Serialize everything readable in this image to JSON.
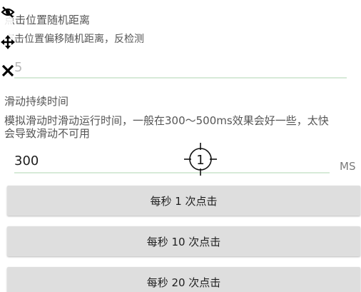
{
  "toolbar": {
    "icons": [
      "eye-off-icon",
      "move-icon",
      "close-icon"
    ]
  },
  "offset": {
    "title": "点击位置随机距离",
    "description": "点击位置偏移随机距离，反检测",
    "input_value": "5"
  },
  "swipe": {
    "title": "滑动持续时间",
    "description_line1": "模拟滑动时滑动运行时间，一般在300～500ms效果会好一些，太快",
    "description_line2": "会导致滑动不可用",
    "input_value": "300",
    "unit": "MS"
  },
  "target": {
    "number": "1"
  },
  "buttons": {
    "per_sec_1": "每秒 1 次点击",
    "per_sec_10": "每秒 10 次点击",
    "per_sec_20": "每秒 20 次点击"
  },
  "colors": {
    "underline": "#d7ead8",
    "button_bg": "#dedede",
    "toolbar_icon": "#000000"
  }
}
